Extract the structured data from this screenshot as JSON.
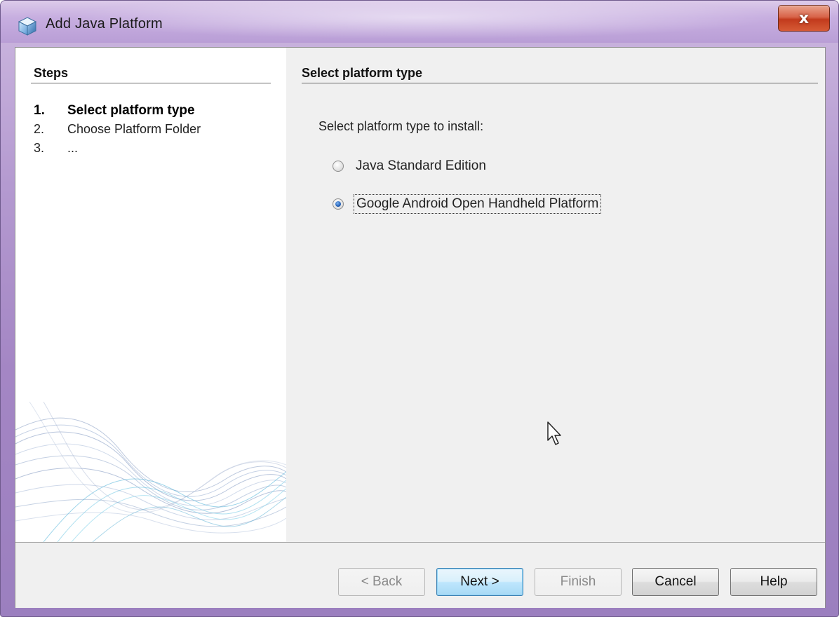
{
  "window": {
    "title": "Add Java Platform",
    "close_label": "x"
  },
  "steps": {
    "header": "Steps",
    "items": [
      {
        "number": "1.",
        "label": "Select platform type",
        "current": true
      },
      {
        "number": "2.",
        "label": "Choose Platform Folder",
        "current": false
      },
      {
        "number": "3.",
        "label": "...",
        "current": false
      }
    ]
  },
  "panel": {
    "title": "Select platform type",
    "instructions": "Select platform type to install:",
    "options": [
      {
        "label": "Java Standard Edition",
        "selected": false
      },
      {
        "label": "Google Android Open Handheld Platform",
        "selected": true
      }
    ]
  },
  "buttons": {
    "back": "< Back",
    "next": "Next >",
    "finish": "Finish",
    "cancel": "Cancel",
    "help": "Help"
  },
  "colors": {
    "accent": "#2562b8",
    "title_bar": "#c7aee0",
    "close_button": "#c23b1d"
  },
  "icons": {
    "window_icon": "java-platform-icon",
    "close": "close-icon",
    "cursor": "mouse-pointer-icon"
  }
}
